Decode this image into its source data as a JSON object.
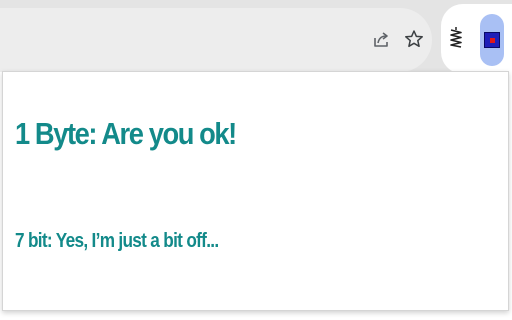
{
  "browser": {
    "toolbar": {
      "icons": [
        "share-icon",
        "bookmark-star-icon"
      ]
    },
    "extensions": {
      "icons": [
        "spring-extension-icon",
        "byte-extension-icon"
      ],
      "active_extension_colors": {
        "highlight": "#a9c0f4",
        "square": "#1f1fb8",
        "center": "#e01818"
      }
    }
  },
  "popup": {
    "title": "1 Byte: Are you ok!",
    "subtitle": "7 bit: Yes, I’m just a bit off...",
    "text_color": "#138a8a"
  }
}
